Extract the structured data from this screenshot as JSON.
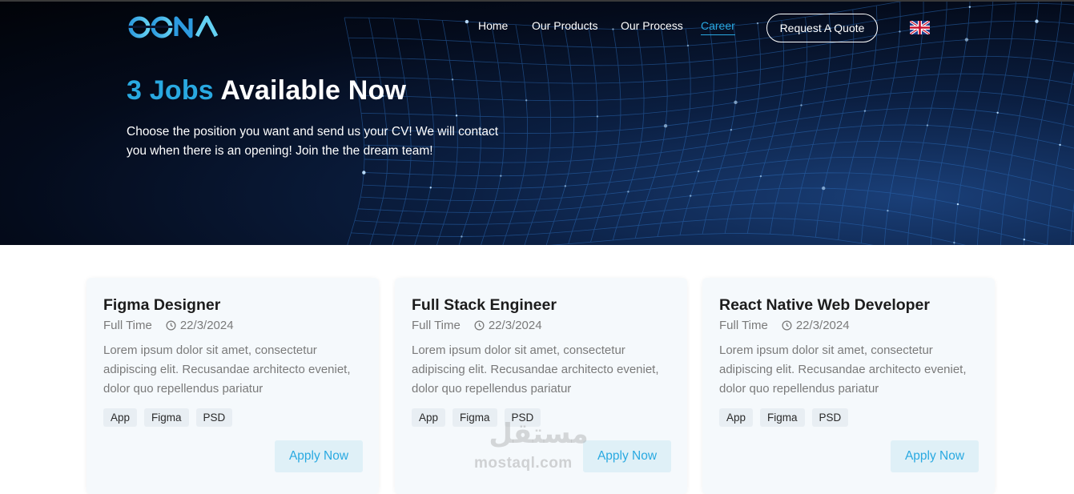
{
  "nav": {
    "logo_text": "OONA",
    "links": [
      {
        "label": "Home"
      },
      {
        "label": "Our Products"
      },
      {
        "label": "Our Process"
      },
      {
        "label": "Career"
      }
    ],
    "active": "Career",
    "quote_label": "Request A Quote",
    "language_icon": "uk-flag-icon"
  },
  "hero": {
    "count": "3 Jobs",
    "title_rest": "Available Now",
    "description": "Choose the position you want and send us your CV! We will contact you when there is an opening! Join the the dream team!"
  },
  "jobs": [
    {
      "title": "Figma Designer",
      "type": "Full Time",
      "date": "22/3/2024",
      "description": "Lorem ipsum dolor sit amet, consectetur adipiscing elit. Recusandae architecto eveniet, dolor quo repellendus pariatur",
      "tags": [
        "App",
        "Figma",
        "PSD"
      ],
      "apply_label": "Apply Now"
    },
    {
      "title": "Full Stack Engineer",
      "type": "Full Time",
      "date": "22/3/2024",
      "description": "Lorem ipsum dolor sit amet, consectetur adipiscing elit. Recusandae architecto eveniet, dolor quo repellendus pariatur",
      "tags": [
        "App",
        "Figma",
        "PSD"
      ],
      "apply_label": "Apply Now"
    },
    {
      "title": "React Native Web Developer",
      "type": "Full Time",
      "date": "22/3/2024",
      "description": "Lorem ipsum dolor sit amet, consectetur adipiscing elit. Recusandae architecto eveniet, dolor quo repellendus pariatur",
      "tags": [
        "App",
        "Figma",
        "PSD"
      ],
      "apply_label": "Apply Now"
    }
  ],
  "watermark": {
    "arabic": "مستقل",
    "latin": "mostaql.com"
  },
  "colors": {
    "accent": "#29a9e1",
    "hero_bg": "#040b1b",
    "card_bg": "#f5f9fc",
    "apply_bg": "#dff0f7"
  }
}
